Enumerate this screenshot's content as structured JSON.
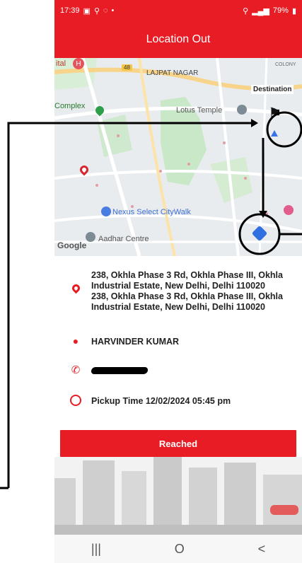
{
  "status_bar": {
    "time": "17:39",
    "battery": "79%"
  },
  "header": {
    "title": "Location Out"
  },
  "map": {
    "labels": {
      "lajpat_nagar": "LAJPAT NAGAR",
      "complex": "Complex",
      "lotus_temple": "Lotus Temple",
      "nexus": "Nexus Select CityWalk",
      "aadhar": "Aadhar Centre",
      "google": "Google",
      "destination": "Destination",
      "ital": "ital",
      "colony": "COLONY",
      "road_number": "48"
    }
  },
  "details": {
    "address_line1": "238, Okhla Phase 3 Rd, Okhla Phase III, Okhla",
    "address_line2": "Industrial Estate, New Delhi, Delhi 110020",
    "address_line3": "238, Okhla Phase 3 Rd, Okhla Phase III, Okhla",
    "address_line4": "Industrial Estate, New Delhi, Delhi 110020",
    "name": "HARVINDER  KUMAR",
    "pickup_time": "Pickup Time 12/02/2024 05:45 pm"
  },
  "actions": {
    "reached_label": "Reached"
  },
  "navbar": {
    "recent": "|||",
    "home": "O",
    "back": "<"
  },
  "colors": {
    "brand": "#e81c24"
  }
}
